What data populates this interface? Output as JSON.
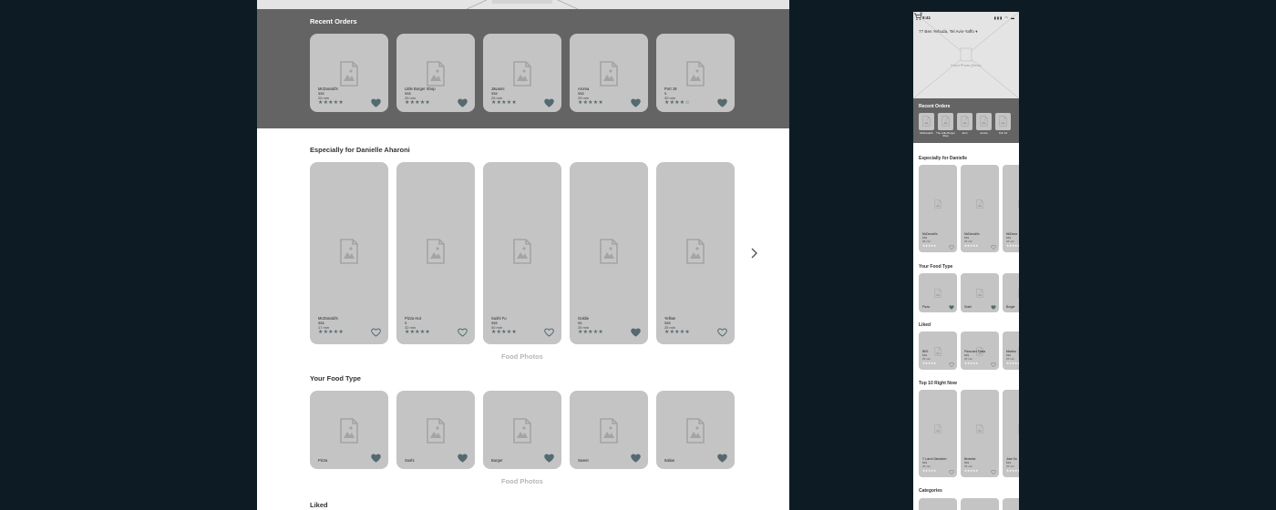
{
  "desktop": {
    "recent_orders": {
      "title": "Recent Orders",
      "cards": [
        {
          "name": "McDonald's",
          "price": "$$$",
          "time": "25 min",
          "stars": "★★★★★",
          "liked": true
        },
        {
          "name": "Little Burger Shop",
          "price": "$$$",
          "time": "25 min",
          "stars": "★★★★★",
          "liked": true
        },
        {
          "name": "Jāvanni",
          "price": "$$$",
          "time": "25 min",
          "stars": "★★★★★",
          "liked": true
        },
        {
          "name": "Aroma",
          "price": "$$$",
          "time": "25 min",
          "stars": "★★★★★",
          "liked": true
        },
        {
          "name": "Port 19",
          "price": "$",
          "time": "30 min",
          "stars": "★★★★☆",
          "liked": true
        }
      ]
    },
    "especially": {
      "title": "Especially for Danielle Aharoni",
      "caption": "Food Photos",
      "cards": [
        {
          "name": "McDonald's",
          "price": "$$$",
          "time": "17 min",
          "stars": "★★★★★",
          "liked": false
        },
        {
          "name": "Pizza Hut",
          "price": "$",
          "time": "32 min",
          "stars": "★★★★★",
          "liked": false
        },
        {
          "name": "Sushi Fu",
          "price": "$$$",
          "time": "30 min",
          "stars": "★★★★★",
          "liked": false
        },
        {
          "name": "Goldie",
          "price": "$$",
          "time": "25 min",
          "stars": "★★★★★",
          "liked": true
        },
        {
          "name": "Yellow",
          "price": "$$$",
          "time": "25 min",
          "stars": "★★★★★",
          "liked": false
        }
      ]
    },
    "food_type": {
      "title": "Your Food Type",
      "caption": "Food Photos",
      "cards": [
        {
          "name": "Pizza",
          "liked": true
        },
        {
          "name": "Sushi",
          "liked": true
        },
        {
          "name": "Burger",
          "liked": true
        },
        {
          "name": "Sweet",
          "liked": true
        },
        {
          "name": "Italian",
          "liked": true
        }
      ]
    },
    "liked": {
      "title": "Liked"
    }
  },
  "mobile": {
    "status_time": "9:41",
    "address": "77 Ben Yehuda, Tel Aviv-Yaffo ▾",
    "hero_label": "Food Photo (Hero)",
    "recent_title": "Recent Orders",
    "recent_items": [
      "McDonald's",
      "The Little Burger Shop",
      "Jen's",
      "Aroma",
      "Port 19"
    ],
    "especially_title": "Especially for Danielle",
    "especially_cards": [
      {
        "name": "McDonald's",
        "price": "$$$",
        "time": "25 min",
        "stars": "★★★★★"
      },
      {
        "name": "McDonald's",
        "price": "$$$",
        "time": "25 min",
        "stars": "★★★★★"
      },
      {
        "name": "McDona",
        "price": "$$$",
        "time": "25 min",
        "stars": "★★★★★"
      }
    ],
    "food_type_title": "Your Food Type",
    "food_type_cards": [
      "Pizza",
      "Sushi",
      "Burger"
    ],
    "liked_title": "Liked",
    "liked_cards": [
      {
        "name": "BKS",
        "price": "$$$",
        "time": "25 min",
        "stars": "★★★★★"
      },
      {
        "name": "Pizza and Pasta",
        "price": "$$$",
        "time": "25 min",
        "stars": "★★★★★"
      },
      {
        "name": "Meatba",
        "price": "$$$",
        "time": "25 min",
        "stars": "★★★★★"
      }
    ],
    "top10_title": "Top 10 Right Now",
    "top10_cards": [
      {
        "name": "Y Lunch Sandwich",
        "price": "$$$",
        "time": "25 min",
        "stars": "★★★★★"
      },
      {
        "name": "Benedict",
        "price": "$$$",
        "time": "25 min",
        "stars": "★★★★★"
      },
      {
        "name": "Jose Go",
        "price": "$$$",
        "time": "25 min",
        "stars": "★★★★★"
      }
    ],
    "categories_title": "Categories"
  },
  "colors": {
    "background": "#0d1c24",
    "band": "#646464",
    "card": "#c4c4c4",
    "accent": "#546a70"
  }
}
